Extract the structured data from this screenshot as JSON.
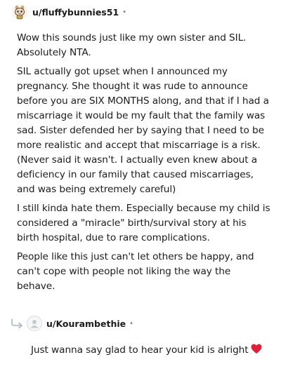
{
  "comments": [
    {
      "username": "u/fluffybunnies51",
      "separator": "•",
      "paragraphs": [
        "Wow this sounds just like my own sister and SIL. Absolutely NTA.",
        "SIL actually got upset when I announced my pregnancy. She thought it was rude to announce before you are SIX MONTHS along, and that if I had a miscarriage it would be my fault that the family was sad. Sister defended her by saying that I need to be more realistic and accept that miscarriage is a risk. (Never said it wasn't. I actually even knew about a deficiency in our family that caused miscarriages, and was being extremely careful)",
        "I still kinda hate them. Especially because my child is considered a \"miracle\" birth/survival story at his birth hospital, due to rare complications.",
        "People like this just can't let others be happy, and can't cope with people not liking the way the behave."
      ]
    },
    {
      "username": "u/Kourambethie",
      "separator": "•",
      "text": "Just wanna say glad to hear your kid is alright",
      "emoji": "heart-icon"
    }
  ],
  "colors": {
    "text": "#1c1c1c",
    "meta": "#7c7c7c",
    "heart": "#e0203a",
    "reply_arrow": "#a8b6c2"
  }
}
